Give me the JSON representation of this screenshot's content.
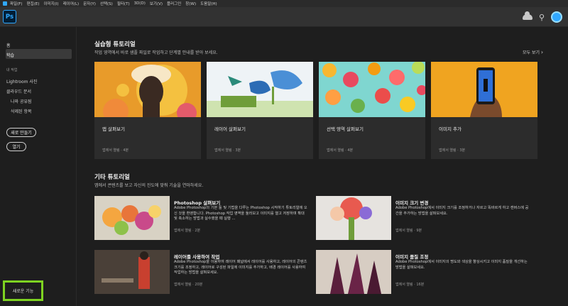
{
  "menubar": {
    "items": [
      "파일(F)",
      "편집(E)",
      "이미지(I)",
      "레이어(L)",
      "문자(Y)",
      "선택(S)",
      "필터(T)",
      "3D(D)",
      "보기(V)",
      "플러그인",
      "창(W)",
      "도움말(H)"
    ]
  },
  "app": {
    "logo_text": "Ps"
  },
  "sidebar": {
    "home": "홈",
    "learn": "학습",
    "your_files_heading": "내 작업",
    "lightroom": "Lightroom 사진",
    "cloud_docs": "클라우드 문서",
    "shared": "나와 공유됨",
    "deleted": "삭제된 항목",
    "new_button": "새로 만들기",
    "open_button": "열기",
    "whats_new": "새로운 기능"
  },
  "hands_on": {
    "title": "실습형 튜토리얼",
    "subtitle": "작업 영역에서 바로 샘플 파일로 작업하고 단계별 안내를 받아 보세요.",
    "see_all": "모두 보기",
    "cards": [
      {
        "title": "앱 살펴보기",
        "meta": "앱에서 열림 · 4분"
      },
      {
        "title": "레이어 살펴보기",
        "meta": "앱에서 열림 · 3분"
      },
      {
        "title": "선택 영역 살펴보기",
        "meta": "앱에서 열림 · 4분"
      },
      {
        "title": "이미지 추가",
        "meta": "앱에서 열림 · 3분"
      }
    ]
  },
  "other": {
    "title": "기타 튜토리얼",
    "subtitle": "앱에서 콘텐츠를 보고 자신의 진도에 맞춰 기술을 연마하세요.",
    "items": [
      {
        "title": "Photoshop 살펴보기",
        "desc": "Adobe Photoshop의 기본 툴 및 기법을 다루는 Photoshop 시작하기 튜토리얼에 오신 것을 환영합니다. Photoshop 작업 영역을 둘러보고 이미지를 열고 저장하며 확대 및 축소하는 방법과 실수했을 때 실행 ...",
        "meta": "앱에서 열림 · 2분"
      },
      {
        "title": "이미지 크기 변경",
        "desc": "Adobe Photoshop에서 이미지 크기를 조정하거나 자르고 똑바르게 하고 캔버스에 공간을 추가하는 방법을 살펴보세요.",
        "meta": "앱에서 열림 · 9분"
      },
      {
        "title": "레이어를 사용하여 작업",
        "desc": "Adobe Photoshop을 이용하여 레이어 패널에서 레이어를 사용하고, 레이어의 콘텐츠 크기를 조정하고, 레이어로 구성된 파일에 이미지를 추가하고, 배경 레이어를 사용하여 작업하는 방법을 살펴보세요.",
        "meta": "앱에서 열림 · 20분"
      },
      {
        "title": "이미지 품질 조정",
        "desc": "Adobe Photoshop에서 이미지의 명도와 색상을 향상시키고 이미지 품질을 개선하는 방법을 살펴보세요.",
        "meta": "앱에서 열림 · 16분"
      }
    ]
  },
  "colors": {
    "accent": "#31a8ff",
    "highlight": "#7ed321"
  }
}
